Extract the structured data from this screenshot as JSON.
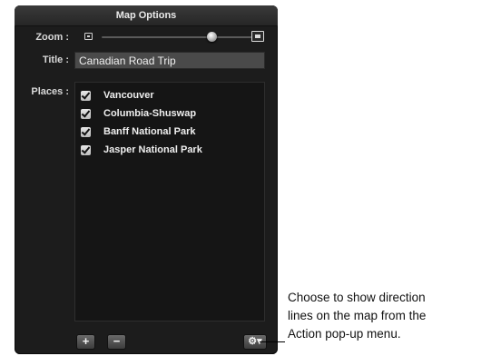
{
  "panel": {
    "title": "Map Options",
    "zoom_label": "Zoom :",
    "zoom_level": 0.75,
    "title_label": "Title :",
    "title_value": "Canadian Road Trip",
    "places_label": "Places :",
    "places": [
      {
        "name": "Vancouver",
        "checked": true
      },
      {
        "name": "Columbia-Shuswap",
        "checked": true
      },
      {
        "name": "Banff National Park",
        "checked": true
      },
      {
        "name": "Jasper National Park",
        "checked": true
      }
    ],
    "add_button": "+",
    "remove_button": "−",
    "action_button": "⚙▾",
    "zoom_small_icon": "zoom-out-icon",
    "zoom_large_icon": "zoom-in-icon"
  },
  "callout": {
    "line1": "Choose to show direction",
    "line2": "lines on the map from the",
    "line3": "Action pop-up menu."
  }
}
